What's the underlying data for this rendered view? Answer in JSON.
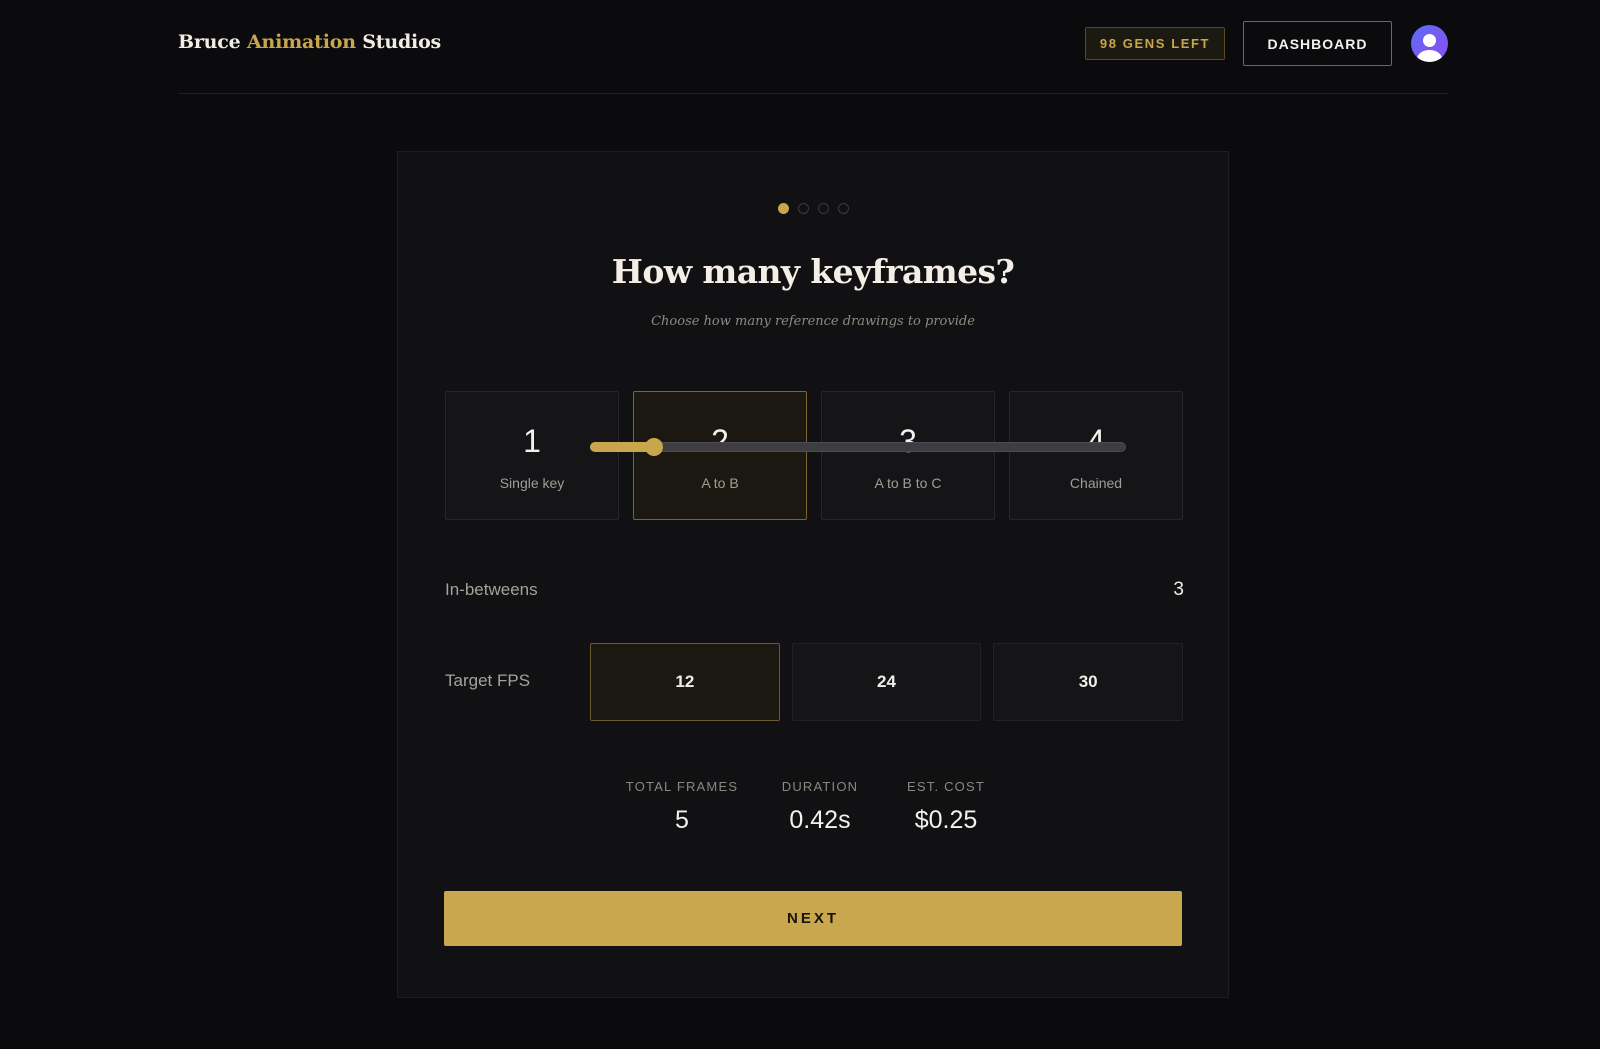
{
  "header": {
    "brand_part1": "Bruce ",
    "brand_accent": "Animation",
    "brand_part2": " Studios",
    "gens_left": "98 GENS LEFT",
    "dashboard_label": "DASHBOARD"
  },
  "wizard": {
    "steps_total": 4,
    "current_step": 1,
    "title": "How many keyframes?",
    "subtitle": "Choose how many reference drawings to provide",
    "keyframe_options": [
      {
        "num": "1",
        "label": "Single key",
        "selected": false
      },
      {
        "num": "2",
        "label": "A to B",
        "selected": true
      },
      {
        "num": "3",
        "label": "A to B to C",
        "selected": false
      },
      {
        "num": "4",
        "label": "Chained",
        "selected": false
      }
    ],
    "inbetweens": {
      "label": "In-betweens",
      "value": "3",
      "fill_fraction": 0.12
    },
    "fps": {
      "label": "Target FPS",
      "options": [
        {
          "value": "12",
          "selected": true
        },
        {
          "value": "24",
          "selected": false
        },
        {
          "value": "30",
          "selected": false
        }
      ]
    },
    "summary": {
      "total_frames_label": "TOTAL FRAMES",
      "total_frames": "5",
      "duration_label": "DURATION",
      "duration": "0.42s",
      "cost_label": "EST. COST",
      "cost": "$0.25"
    },
    "next_label": "NEXT"
  },
  "colors": {
    "accent": "#c9a64b",
    "background": "#0b0a0d",
    "card": "#111013"
  }
}
